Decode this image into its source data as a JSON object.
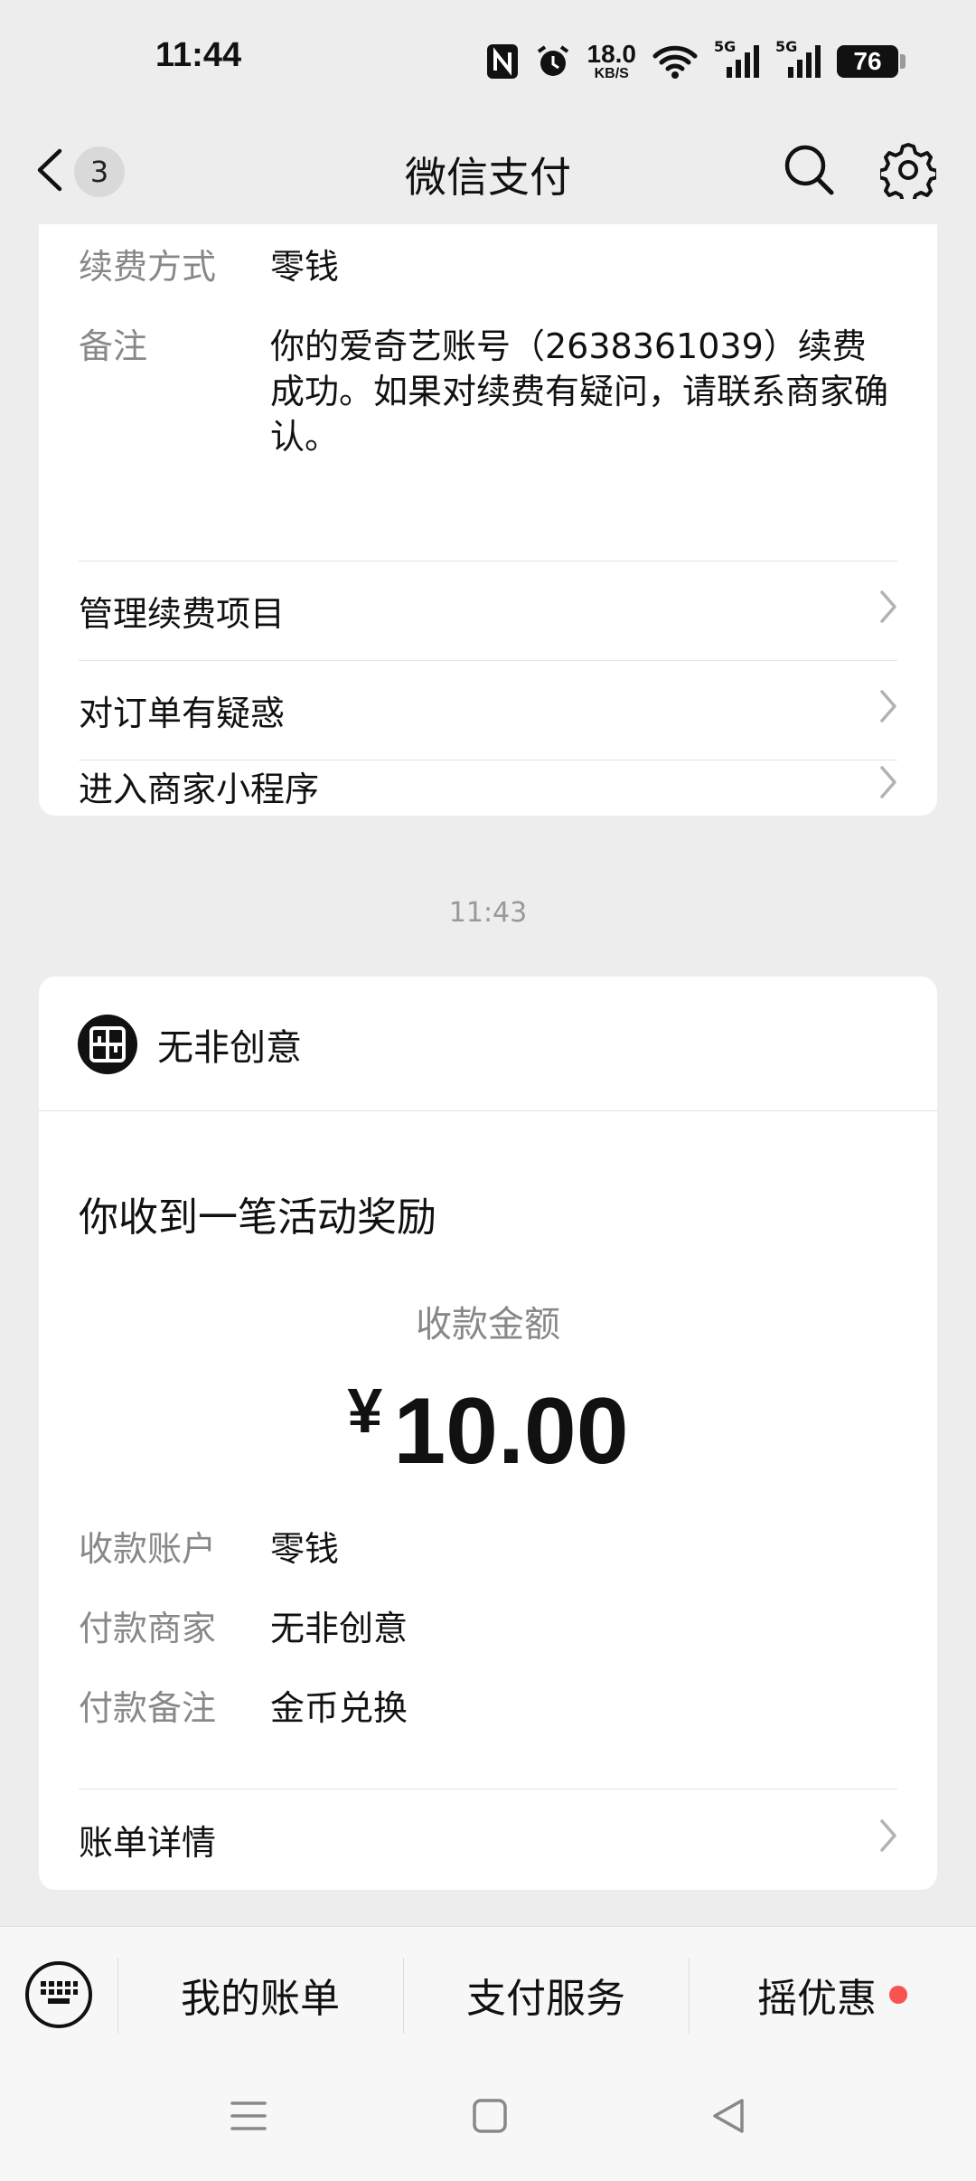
{
  "status_bar": {
    "time": "11:44",
    "net_speed_value": "18.0",
    "net_speed_unit": "KB/S",
    "network_1": "5G",
    "network_2": "5G",
    "battery": "76",
    "icons": [
      "nfc-icon",
      "alarm-icon",
      "wifi-icon",
      "signal-icon",
      "signal-icon",
      "battery-icon"
    ]
  },
  "header": {
    "title": "微信支付",
    "unread_count": "3",
    "icons": [
      "back-chevron-icon",
      "search-icon",
      "gear-icon"
    ]
  },
  "card1": {
    "rows": [
      {
        "label": "续费方式",
        "value": "零钱"
      },
      {
        "label": "备注",
        "value": "你的爱奇艺账号（2638361039）续费成功。如果对续费有疑问，请联系商家确认。"
      }
    ],
    "links": [
      "管理续费项目",
      "对订单有疑惑",
      "进入商家小程序"
    ]
  },
  "timestamp": "11:43",
  "card2": {
    "merchant": "无非创意",
    "title": "你收到一笔活动奖励",
    "amount_label": "收款金额",
    "currency": "¥",
    "amount": "10.00",
    "rows": [
      {
        "label": "收款账户",
        "value": "零钱"
      },
      {
        "label": "付款商家",
        "value": "无非创意"
      },
      {
        "label": "付款备注",
        "value": "金币兑换"
      }
    ],
    "link": "账单详情"
  },
  "tabbar": {
    "tabs": [
      "我的账单",
      "支付服务",
      "摇优惠"
    ],
    "icons": [
      "keyboard-icon"
    ],
    "accent": "#fa5151"
  }
}
